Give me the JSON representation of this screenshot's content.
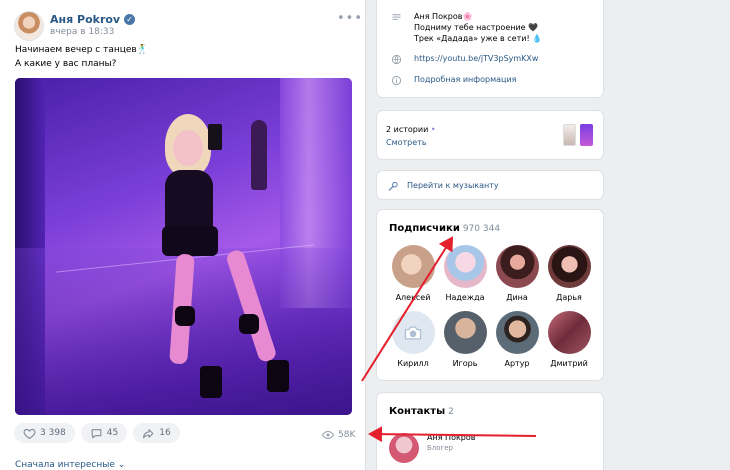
{
  "post": {
    "author": "Аня Pokrov",
    "time": "вчера в 18:33",
    "text_line1": "Начинаем вечер с танцев🕺",
    "text_line2": "А какие у вас планы?",
    "more": "•••",
    "likes": "3 398",
    "comments": "45",
    "reposts": "16",
    "views": "58K",
    "sort_label": "Сначала интересные"
  },
  "profile": {
    "status_line1": "Аня Покров🌸",
    "status_line2": "Подниму тебе настроение 🖤",
    "status_line3": "Трек «Дадада» уже в сети! 💧",
    "website": "https://youtu.be/jTV3pSymKXw",
    "details_link": "Подробная информация"
  },
  "stories": {
    "count_label": "2 истории",
    "dot": "•",
    "watch_label": "Смотреть"
  },
  "music": {
    "link_label": "Перейти к музыканту"
  },
  "subscribers": {
    "title": "Подписчики",
    "count": "970 344",
    "people": [
      {
        "name": "Алексей",
        "color": "#c9a08a"
      },
      {
        "name": "Надежда",
        "color": "#e6b7c9"
      },
      {
        "name": "Дина",
        "color": "#8a4a4f"
      },
      {
        "name": "Дарья",
        "color": "#6e3a3a"
      },
      {
        "name": "Кирилл",
        "color": ""
      },
      {
        "name": "Игорь",
        "color": "#55606a"
      },
      {
        "name": "Артур",
        "color": "#5b6b78"
      },
      {
        "name": "Дмитрий",
        "color": "#a05561"
      }
    ]
  },
  "contacts": {
    "title": "Контакты",
    "count": "2",
    "name": "Аня Покров",
    "role": "Блогер"
  },
  "colors": {
    "link": "#2a5885",
    "annotation_arrow": "#e4202d"
  }
}
